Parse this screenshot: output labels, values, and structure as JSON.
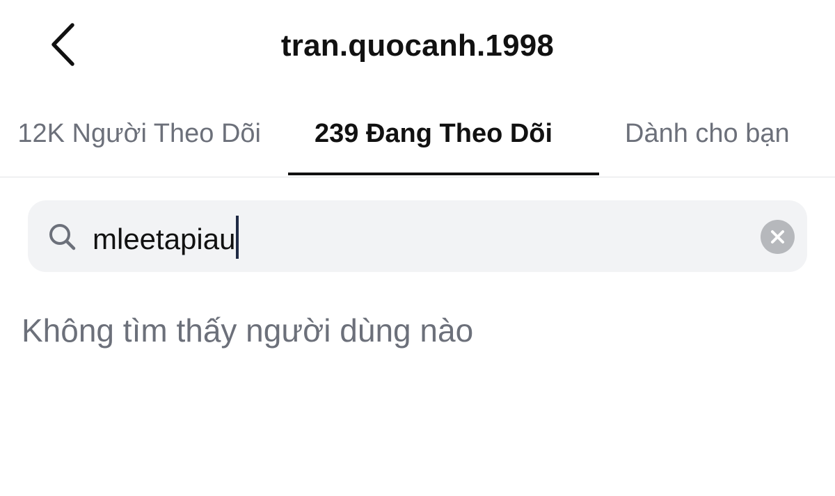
{
  "header": {
    "title": "tran.quocanh.1998",
    "back_icon": "chevron-left-icon"
  },
  "tabs": [
    {
      "label": "12K Người Theo Dõi",
      "active": false
    },
    {
      "label": "239 Đang Theo Dõi",
      "active": true
    },
    {
      "label": "Dành cho bạn",
      "active": false
    }
  ],
  "search": {
    "icon": "search-icon",
    "value": "mleetapiau",
    "clear_icon": "close-icon"
  },
  "results": {
    "empty_message": "Không tìm thấy người dùng nào"
  },
  "colors": {
    "text_primary": "#111111",
    "text_secondary": "#6c707a",
    "search_background": "#f2f3f5",
    "clear_button": "#b6b8bc",
    "divider": "#e2e3e6"
  }
}
